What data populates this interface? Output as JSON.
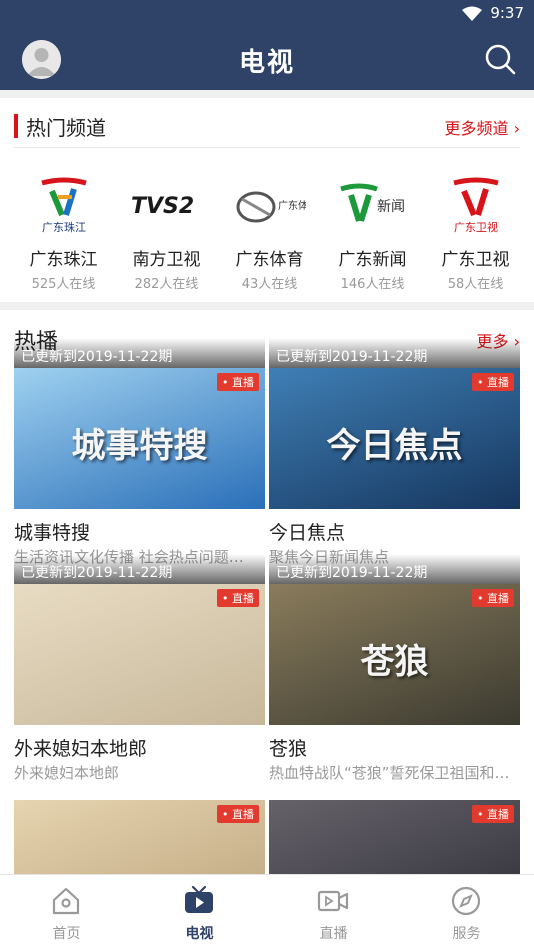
{
  "status_bar": {
    "time": "9:37"
  },
  "header": {
    "title": "电视"
  },
  "channels_section": {
    "title": "热门频道",
    "more": "更多频道 ›",
    "channels": [
      {
        "name": "广东珠江",
        "online": "525人在线",
        "logo_text": "广东珠江"
      },
      {
        "name": "南方卫视",
        "online": "282人在线",
        "logo_text": "TVS2"
      },
      {
        "name": "广东体育",
        "online": "43人在线",
        "logo_text": "广东体育"
      },
      {
        "name": "广东新闻",
        "online": "146人在线",
        "logo_text": "新闻"
      },
      {
        "name": "广东卫视",
        "online": "58人在线",
        "logo_text": "广东卫视"
      }
    ]
  },
  "hot_section": {
    "title": "热播",
    "more": "更多 ›",
    "live_badge": "• 直播",
    "items": [
      {
        "title": "城事特搜",
        "desc": "生活资讯文化传播 社会热点问题…",
        "update": "已更新到2019-11-22期",
        "thumb_text": "城事特搜",
        "colors": [
          "#2a6fb8",
          "#9fd1f0"
        ]
      },
      {
        "title": "今日焦点",
        "desc": "聚焦今日新闻焦点",
        "update": "已更新到2019-11-22期",
        "thumb_text": "今日焦点",
        "colors": [
          "#16365e",
          "#3f7fb5"
        ]
      },
      {
        "title": "外来媳妇本地郎",
        "desc": "外来媳妇本地郎",
        "update": "已更新到2019-11-22期",
        "thumb_text": "",
        "colors": [
          "#c7b89a",
          "#e8dcc4"
        ]
      },
      {
        "title": "苍狼",
        "desc": "热血特战队“苍狼”誓死保卫祖国和…",
        "update": "已更新到2019-11-22期",
        "thumb_text": "苍狼",
        "colors": [
          "#3b3a30",
          "#8a7c5c"
        ]
      },
      {
        "title": "",
        "desc": "",
        "update": "",
        "thumb_text": "",
        "colors": [
          "#b9a17a",
          "#e6d4b0"
        ]
      },
      {
        "title": "",
        "desc": "",
        "update": "",
        "thumb_text": "",
        "colors": [
          "#2b2b33",
          "#66626a"
        ]
      }
    ]
  },
  "tabbar": {
    "tabs": [
      {
        "label": "首页",
        "icon": "home-icon"
      },
      {
        "label": "电视",
        "icon": "tv-icon"
      },
      {
        "label": "直播",
        "icon": "video-camera-icon"
      },
      {
        "label": "服务",
        "icon": "compass-icon"
      }
    ],
    "active_index": 1
  },
  "colors": {
    "header_bg": "#2f4268",
    "accent_red": "#d7141a",
    "active_tab": "#2f4268"
  }
}
